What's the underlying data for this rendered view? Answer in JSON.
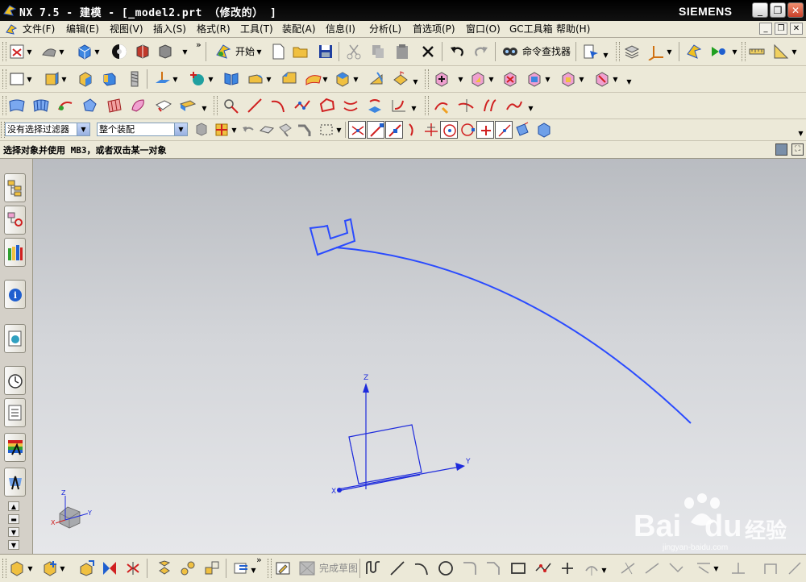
{
  "window": {
    "title": "NX 7.5 - 建模 - [_model2.prt （修改的） ]",
    "brand": "SIEMENS",
    "min_icon": "minimize-icon",
    "max_icon": "restore-icon",
    "close_icon": "close-icon"
  },
  "menu": {
    "items": [
      "文件(F)",
      "编辑(E)",
      "视图(V)",
      "插入(S)",
      "格式(R)",
      "工具(T)",
      "装配(A)",
      "信息(I)",
      "分析(L)",
      "首选项(P)",
      "窗口(O)",
      "GC工具箱",
      "帮助(H)"
    ]
  },
  "toolbar": {
    "start_label": "开始",
    "command_finder_label": "命令查找器",
    "more_glyph": "»"
  },
  "selection_bar": {
    "filter_value": "没有选择过滤器",
    "scope_value": "整个装配"
  },
  "status": {
    "prompt": "选择对象并使用 MB3，或者双击某一对象"
  },
  "viewport": {
    "axis_labels": {
      "x": "X",
      "y": "Y",
      "z": "Z"
    },
    "triad_labels": {
      "x": "X",
      "y": "Y",
      "z": "Z"
    },
    "curve_color": "#2a4bff",
    "csys_color": "#1e2bdc"
  },
  "sketch_toolbar": {
    "finish_sketch_label": "完成草图"
  },
  "watermark": {
    "logo_text": "Bai",
    "logo_text2": "du",
    "cn_text": "经验",
    "url": "jingyan-baidu.com"
  }
}
